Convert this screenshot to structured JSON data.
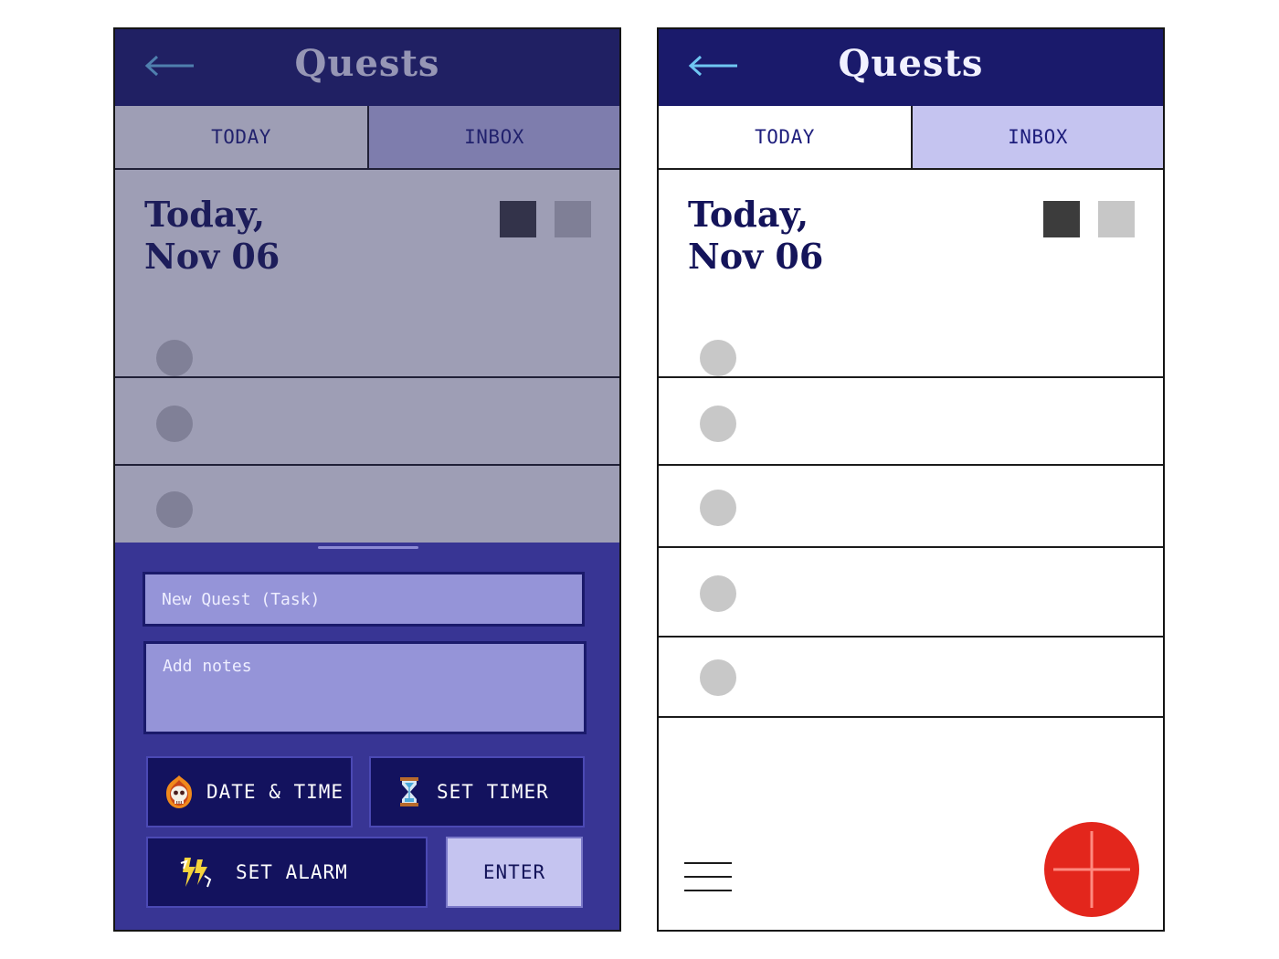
{
  "screens": {
    "left": {
      "header": {
        "title": "Quests"
      },
      "tabs": [
        {
          "label": "TODAY"
        },
        {
          "label": "INBOX"
        }
      ],
      "date_heading": {
        "line1": "Today,",
        "line2": "Nov 06"
      },
      "new_task_sheet": {
        "quest_placeholder": "New Quest (Task)",
        "notes_placeholder": "Add notes",
        "date_time_label": "DATE & TIME",
        "set_timer_label": "SET TIMER",
        "set_alarm_label": "SET ALARM",
        "enter_label": "ENTER"
      }
    },
    "right": {
      "header": {
        "title": "Quests"
      },
      "tabs": [
        {
          "label": "TODAY"
        },
        {
          "label": "INBOX"
        }
      ],
      "date_heading": {
        "line1": "Today,",
        "line2": "Nov 06"
      }
    }
  },
  "icons": {
    "back": "arrow-left-icon",
    "date_time": "flaming-skull-icon",
    "timer": "hourglass-icon",
    "alarm": "lightning-icon",
    "menu": "hamburger-menu-icon",
    "add": "plus-icon"
  },
  "colors": {
    "header_bg": "#1a1a6b",
    "tab_active_bg": "#c5c4f0",
    "sheet_bg": "#383594",
    "field_bg": "#9594d8",
    "button_bg": "#13125e",
    "fab_bg": "#e3261c",
    "swatch_dark": "#3c3c3c",
    "swatch_light": "#c7c7c7"
  }
}
